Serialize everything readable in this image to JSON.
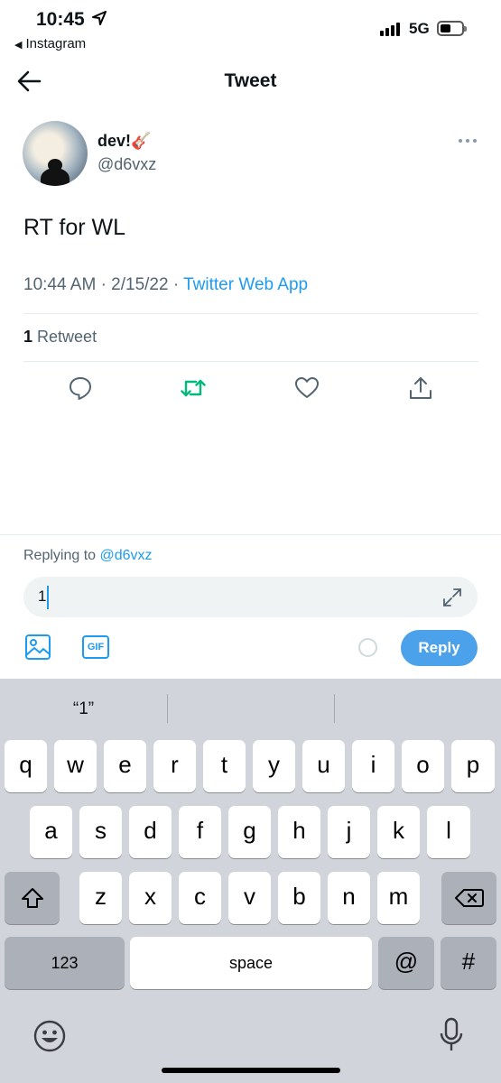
{
  "status_bar": {
    "time": "10:45",
    "back_app": "Instagram",
    "network": "5G"
  },
  "header": {
    "title": "Tweet",
    "back_icon": "back-arrow-icon"
  },
  "tweet": {
    "display_name": "dev!🎸",
    "handle": "@d6vxz",
    "text": "RT for WL",
    "time": "10:44 AM",
    "date": "2/15/22",
    "source": "Twitter Web App",
    "retweet_count": "1",
    "retweet_label": "Retweet"
  },
  "actions": [
    "reply-icon",
    "retweet-icon",
    "like-icon",
    "share-icon"
  ],
  "colors": {
    "accent": "#1d9bf0",
    "retweet_green": "#00ba7c",
    "reply_button": "#4ba1ea",
    "keyboard_bg": "#d1d4da"
  },
  "composer": {
    "replying_prefix": "Replying to",
    "replying_to": "@d6vxz",
    "input_value": "1",
    "gif_label": "GIF",
    "reply_button": "Reply"
  },
  "keyboard": {
    "suggestions": [
      "“1”",
      "",
      ""
    ],
    "row1": [
      "q",
      "w",
      "e",
      "r",
      "t",
      "y",
      "u",
      "i",
      "o",
      "p"
    ],
    "row2": [
      "a",
      "s",
      "d",
      "f",
      "g",
      "h",
      "j",
      "k",
      "l"
    ],
    "row3": [
      "z",
      "x",
      "c",
      "v",
      "b",
      "n",
      "m"
    ],
    "numbers_key": "123",
    "space_key": "space",
    "at_key": "@",
    "hash_key": "#"
  }
}
